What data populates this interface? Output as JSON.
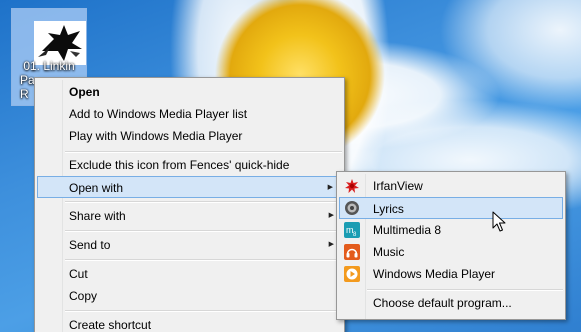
{
  "desktop": {
    "file": {
      "line1": "01. Linkin",
      "line2": "Pa",
      "line3": "R"
    }
  },
  "context_menu": {
    "items": {
      "open": "Open",
      "add_wmp": "Add to Windows Media Player list",
      "play_wmp": "Play with Windows Media Player",
      "exclude_fences": "Exclude this icon from Fences' quick-hide",
      "open_with": "Open with",
      "share_with": "Share with",
      "send_to": "Send to",
      "cut": "Cut",
      "copy": "Copy",
      "create_shortcut": "Create shortcut"
    }
  },
  "open_with_submenu": {
    "items": [
      {
        "label": "IrfanView",
        "icon": "irfanview-icon"
      },
      {
        "label": "Lyrics",
        "icon": "lyrics-icon"
      },
      {
        "label": "Multimedia 8",
        "icon": "multimedia-icon"
      },
      {
        "label": "Music",
        "icon": "music-icon"
      },
      {
        "label": "Windows Media Player",
        "icon": "wmp-icon"
      }
    ],
    "choose_default": "Choose default program..."
  },
  "colors": {
    "menu_background": "#f0f0f0",
    "highlight_fill": "#d3e5f8",
    "highlight_border": "#78aee5",
    "desktop_blue": "#2f7fd0"
  }
}
